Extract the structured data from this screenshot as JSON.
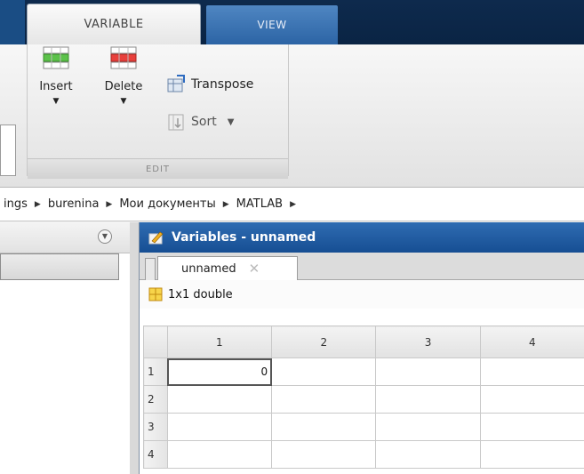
{
  "ribbon_tabs": {
    "variable": "VARIABLE",
    "view": "VIEW"
  },
  "edit_group": {
    "title": "EDIT",
    "insert_label": "Insert",
    "delete_label": "Delete",
    "transpose_label": "Transpose",
    "sort_label": "Sort"
  },
  "breadcrumb": {
    "items": [
      "ings",
      "burenina",
      "Мои документы",
      "MATLAB"
    ]
  },
  "variables_window": {
    "title": "Variables - unnamed",
    "tab_label": "unnamed",
    "type_label": "1x1 double"
  },
  "grid": {
    "columns": [
      "1",
      "2",
      "3",
      "4"
    ],
    "rows": [
      {
        "header": "1",
        "cells": [
          "0",
          "",
          "",
          ""
        ]
      },
      {
        "header": "2",
        "cells": [
          "",
          "",
          "",
          ""
        ]
      },
      {
        "header": "3",
        "cells": [
          "",
          "",
          "",
          ""
        ]
      },
      {
        "header": "4",
        "cells": [
          "",
          "",
          "",
          ""
        ]
      }
    ]
  },
  "colors": {
    "titlebar": "#1f5ba3",
    "tab_view": "#3a72b4",
    "tabstrip": "#0c2748"
  }
}
